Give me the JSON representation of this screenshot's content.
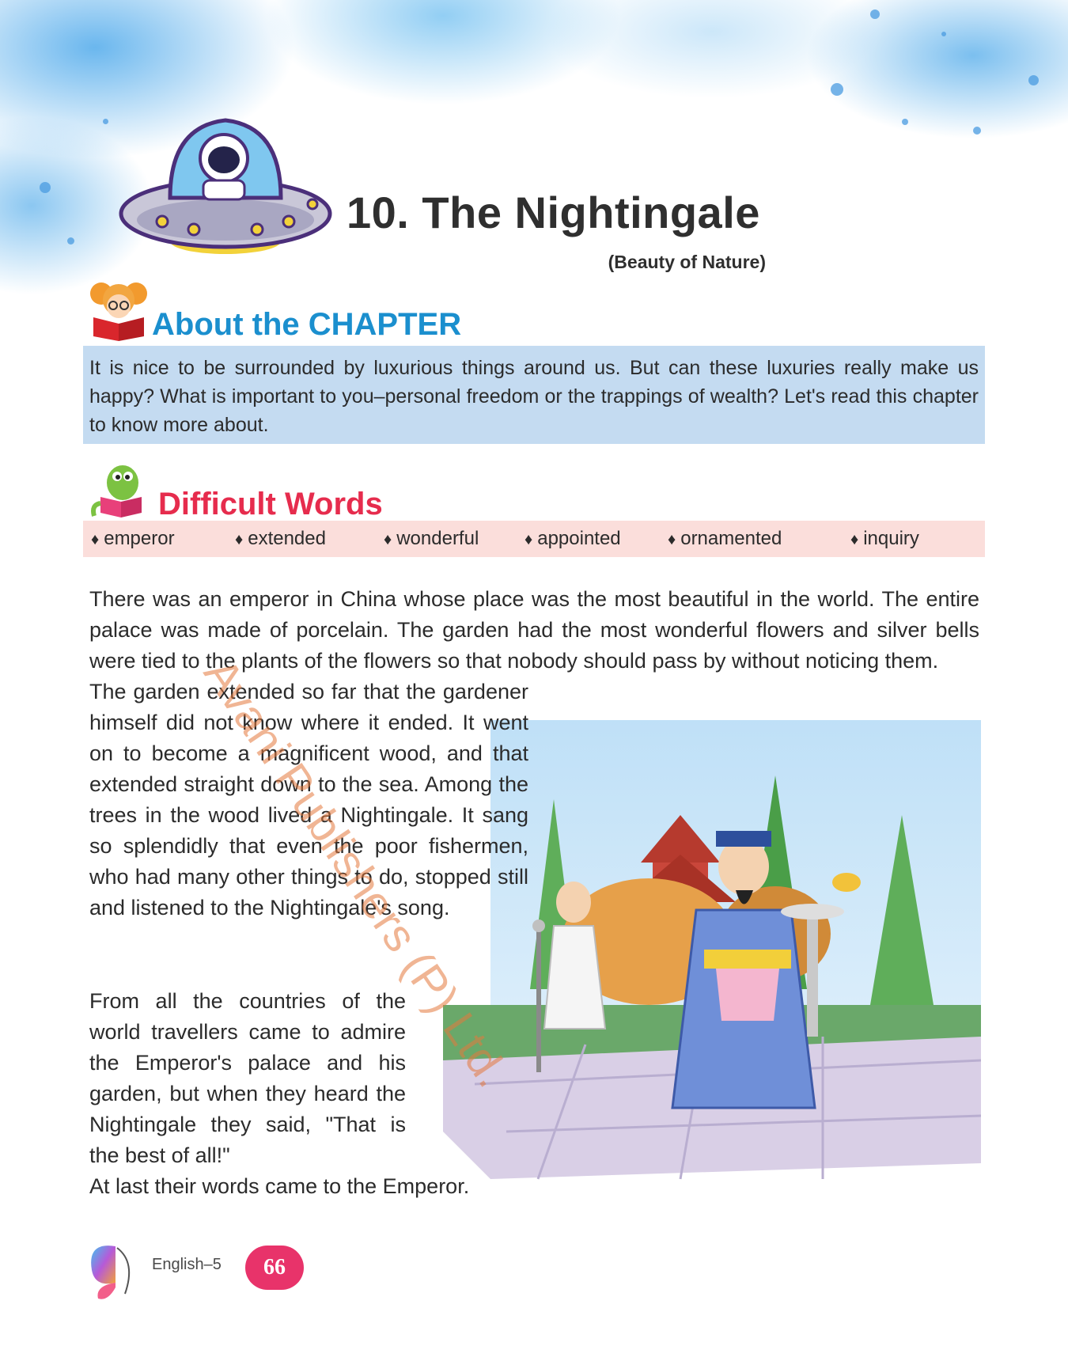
{
  "chapter": {
    "title": "10. The Nightingale",
    "theme": "(Beauty of Nature)"
  },
  "about": {
    "heading": "About the CHAPTER",
    "text": "It is nice to be surrounded by luxurious things around us. But can these luxuries really make us happy? What is important to you–personal freedom or the trappings of wealth? Let's read this chapter to know more about."
  },
  "difficult_words": {
    "heading": "Difficult Words",
    "bullet": "♦",
    "items": [
      "emperor",
      "extended",
      "wonderful",
      "appointed",
      "ornamented",
      "inquiry"
    ]
  },
  "story": {
    "intro": "There was an emperor in China whose place was the most beautiful in the world. The entire palace was made of porcelain. The garden had the most wonderful flowers and silver bells were tied to the plants of the flowers so that nobody should pass by without noticing them.",
    "para1": "The garden extended so far that the gardener himself did not know where it ended. It went on to become a magnificent wood, and that extended straight down to the sea. Among the trees in the wood lived a Nightingale. It sang so splendidly that even the poor fishermen, who had many other things to do, stopped still and listened to the Nightingale's song.",
    "para2": "From all the countries of the world travellers came to admire the Emperor's palace and his garden, but when they heard the Nightingale they said, \"That is the best of all!\"",
    "para3": "At last their words came to the Emperor."
  },
  "watermark": "Avani Publishers (P) Ltd.",
  "footer": {
    "book": "English–5",
    "page": "66"
  },
  "colors": {
    "about_heading": "#1b8fce",
    "words_heading": "#e62c4d",
    "about_box": "#c4dbf1",
    "words_bar": "#fbdedb",
    "page_badge": "#e8336a"
  }
}
